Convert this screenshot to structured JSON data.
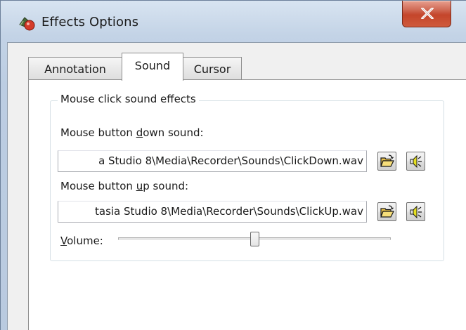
{
  "window": {
    "title": "Effects Options",
    "close_symbol": "X"
  },
  "tabs": [
    {
      "label": "Annotation",
      "selected": false
    },
    {
      "label": "Sound",
      "selected": true
    },
    {
      "label": "Cursor",
      "selected": false
    }
  ],
  "sound": {
    "group_title": "Mouse click sound effects",
    "down": {
      "label_before": "Mouse button ",
      "label_mnemonic": "d",
      "label_after": "own sound:",
      "path": "a Studio 8\\Media\\Recorder\\Sounds\\ClickDown.wav",
      "browse_icon": "open-folder-icon",
      "play_icon": "speaker-icon"
    },
    "up": {
      "label_before": "Mouse button ",
      "label_mnemonic": "u",
      "label_after": "p sound:",
      "path": "tasia Studio 8\\Media\\Recorder\\Sounds\\ClickUp.wav",
      "browse_icon": "open-folder-icon",
      "play_icon": "speaker-icon"
    },
    "volume": {
      "label_mnemonic": "V",
      "label_after": "olume:",
      "level": 0.5
    }
  },
  "colors": {
    "close_button": "#c4452b",
    "frame": "#c3d3e6",
    "panel": "#ffffff"
  }
}
